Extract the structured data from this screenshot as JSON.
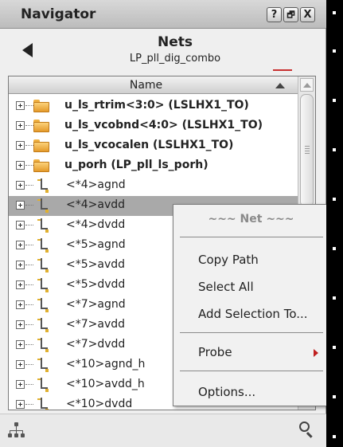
{
  "window": {
    "title": "Navigator",
    "buttons": {
      "help": "?",
      "float": "🗗",
      "close": "X"
    }
  },
  "nav": {
    "title": "Nets",
    "subtitle": "LP_pll_dig_combo",
    "back_icon": "back-arrow-icon"
  },
  "tree": {
    "column_header": "Name",
    "rows": [
      {
        "label": "u_ls_rtrim<3:0> (LSLHX1_TO)",
        "kind": "group"
      },
      {
        "label": "u_ls_vcobnd<4:0> (LSLHX1_TO)",
        "kind": "group"
      },
      {
        "label": "u_ls_vcocalen (LSLHX1_TO)",
        "kind": "group"
      },
      {
        "label": "u_porh (LP_pll_ls_porh)",
        "kind": "group"
      },
      {
        "label": "<*4>agnd",
        "kind": "net"
      },
      {
        "label": "<*4>avdd",
        "kind": "net",
        "selected": true
      },
      {
        "label": "<*4>dvdd",
        "kind": "net"
      },
      {
        "label": "<*5>agnd",
        "kind": "net"
      },
      {
        "label": "<*5>avdd",
        "kind": "net"
      },
      {
        "label": "<*5>dvdd",
        "kind": "net"
      },
      {
        "label": "<*7>agnd",
        "kind": "net"
      },
      {
        "label": "<*7>avdd",
        "kind": "net"
      },
      {
        "label": "<*7>dvdd",
        "kind": "net"
      },
      {
        "label": "<*10>agnd_h",
        "kind": "net"
      },
      {
        "label": "<*10>avdd_h",
        "kind": "net"
      },
      {
        "label": "<*10>dvdd",
        "kind": "net"
      }
    ]
  },
  "context_menu": {
    "header": "~~~ Net ~~~",
    "items": {
      "copy_path": "Copy Path",
      "select_all": "Select All",
      "add_selection": "Add Selection To...",
      "probe": "Probe",
      "options": "Options..."
    }
  },
  "bottom": {
    "left_icon": "hierarchy-icon",
    "right_icon": "search-icon"
  },
  "colors": {
    "selection": "#a9a9a9",
    "accent_red": "#c02020",
    "folder": "#f0b040"
  }
}
